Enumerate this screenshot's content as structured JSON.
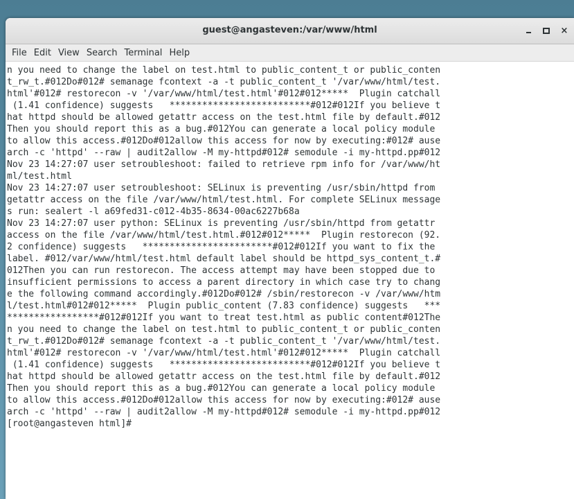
{
  "window": {
    "title": "guest@angasteven:/var/www/html",
    "min_icon": "minimize-icon",
    "max_icon": "maximize-icon",
    "close_icon": "close-icon",
    "close_glyph": "×"
  },
  "menu": [
    "File",
    "Edit",
    "View",
    "Search",
    "Terminal",
    "Help"
  ],
  "terminal": {
    "lines": [
      "n you need to change the label on test.html to public_content_t or public_conten",
      "t_rw_t.#012Do#012# semanage fcontext -a -t public_content_t '/var/www/html/test.",
      "html'#012# restorecon -v '/var/www/html/test.html'#012#012*****  Plugin catchall",
      " (1.41 confidence) suggests   **************************#012#012If you believe t",
      "hat httpd should be allowed getattr access on the test.html file by default.#012",
      "Then you should report this as a bug.#012You can generate a local policy module",
      "to allow this access.#012Do#012allow this access for now by executing:#012# ause",
      "arch -c 'httpd' --raw | audit2allow -M my-httpd#012# semodule -i my-httpd.pp#012",
      "Nov 23 14:27:07 user setroubleshoot: failed to retrieve rpm info for /var/www/ht",
      "ml/test.html",
      "Nov 23 14:27:07 user setroubleshoot: SELinux is preventing /usr/sbin/httpd from",
      "getattr access on the file /var/www/html/test.html. For complete SELinux message",
      "s run: sealert -l a69fed31-c012-4b35-8634-00ac6227b68a",
      "Nov 23 14:27:07 user python: SELinux is preventing /usr/sbin/httpd from getattr",
      "access on the file /var/www/html/test.html.#012#012*****  Plugin restorecon (92.",
      "2 confidence) suggests   ************************#012#012If you want to fix the",
      "label. #012/var/www/html/test.html default label should be httpd_sys_content_t.#",
      "012Then you can run restorecon. The access attempt may have been stopped due to",
      "insufficient permissions to access a parent directory in which case try to chang",
      "e the following command accordingly.#012Do#012# /sbin/restorecon -v /var/www/htm",
      "l/test.html#012#012*****  Plugin public_content (7.83 confidence) suggests   ***",
      "*****************#012#012If you want to treat test.html as public content#012The",
      "n you need to change the label on test.html to public_content_t or public_conten",
      "t_rw_t.#012Do#012# semanage fcontext -a -t public_content_t '/var/www/html/test.",
      "html'#012# restorecon -v '/var/www/html/test.html'#012#012*****  Plugin catchall",
      " (1.41 confidence) suggests   **************************#012#012If you believe t",
      "hat httpd should be allowed getattr access on the test.html file by default.#012",
      "Then you should report this as a bug.#012You can generate a local policy module",
      "to allow this access.#012Do#012allow this access for now by executing:#012# ause",
      "arch -c 'httpd' --raw | audit2allow -M my-httpd#012# semodule -i my-httpd.pp#012",
      "[root@angasteven html]# "
    ]
  }
}
